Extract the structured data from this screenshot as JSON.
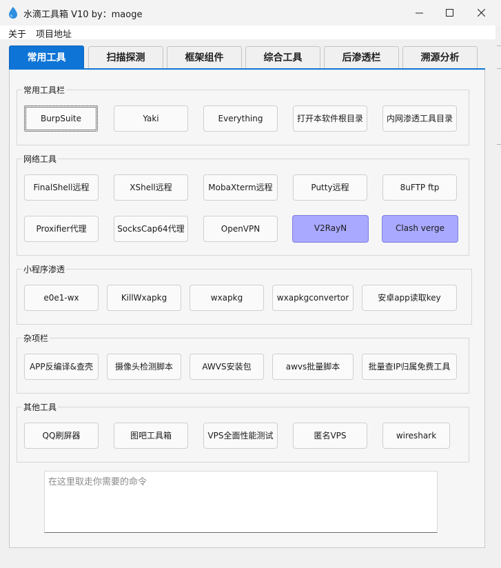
{
  "window": {
    "title": "水滴工具箱 V10 by：maoge",
    "icon": "water-drop-icon",
    "controls": [
      "minimize-icon",
      "maximize-icon",
      "close-icon"
    ]
  },
  "menu": {
    "items": [
      "关于",
      "项目地址"
    ]
  },
  "tabs": [
    {
      "label": "常用工具",
      "active": true
    },
    {
      "label": "扫描探测",
      "active": false
    },
    {
      "label": "框架组件",
      "active": false
    },
    {
      "label": "综合工具",
      "active": false
    },
    {
      "label": "后渗透栏",
      "active": false
    },
    {
      "label": "溯源分析",
      "active": false
    }
  ],
  "groups": {
    "common": {
      "title": "常用工具栏",
      "buttons": [
        "BurpSuite",
        "Yaki",
        "Everything",
        "打开本软件根目录",
        "内网渗透工具目录"
      ]
    },
    "network": {
      "title": "网络工具",
      "buttons": [
        "FinalShell远程",
        "XShell远程",
        "MobaXterm远程",
        "Putty远程",
        "8uFTP ftp",
        "Proxifier代理",
        "SocksCap64代理",
        "OpenVPN",
        "V2RayN",
        "Clash verge"
      ]
    },
    "miniprogram": {
      "title": "小程序渗透",
      "buttons": [
        "e0e1-wx",
        "KillWxapkg",
        "wxapkg",
        "wxapkgconvertor",
        "安卓app读取key"
      ]
    },
    "misc": {
      "title": "杂项栏",
      "buttons": [
        "APP反编译&查壳",
        "摄像头检测脚本",
        "AWVS安装包",
        "awvs批量脚本",
        "批量查IP归属免费工具"
      ]
    },
    "other": {
      "title": "其他工具",
      "buttons": [
        "QQ刷屏器",
        "图吧工具箱",
        "VPS全面性能测试",
        "匿名VPS",
        "wireshark"
      ]
    }
  },
  "command_box": {
    "placeholder": "在这里取走你需要的命令"
  },
  "colors": {
    "active_tab": "#0e74d6",
    "highlight_button": "#a9a9ff"
  }
}
